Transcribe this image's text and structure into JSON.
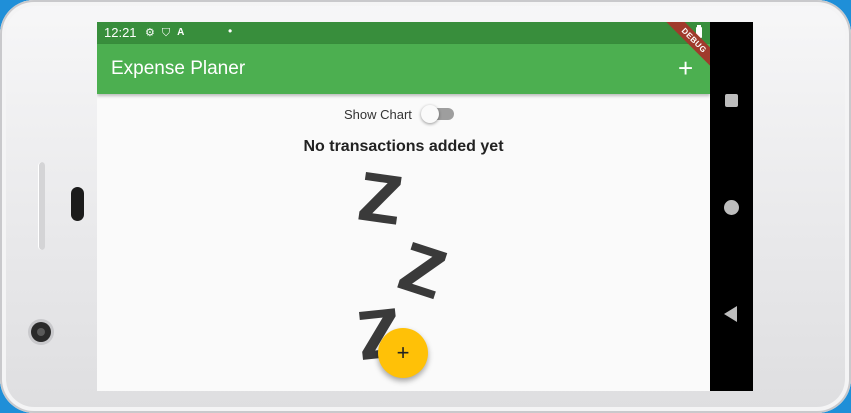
{
  "status_bar": {
    "time": "12:21",
    "icons": [
      "settings-icon",
      "shield-icon",
      "a-icon"
    ],
    "debug_banner": "DEBUG"
  },
  "app_bar": {
    "title": "Expense Planer",
    "add_icon": "+"
  },
  "switch": {
    "label": "Show Chart",
    "state": "off"
  },
  "empty_state": {
    "message": "No transactions added yet",
    "illustration": "waiting-zzz"
  },
  "fab": {
    "icon": "+"
  },
  "colors": {
    "status_bar": "#388e3c",
    "app_bar": "#4caf50",
    "fab": "#ffc107",
    "background": "#fafafa"
  }
}
